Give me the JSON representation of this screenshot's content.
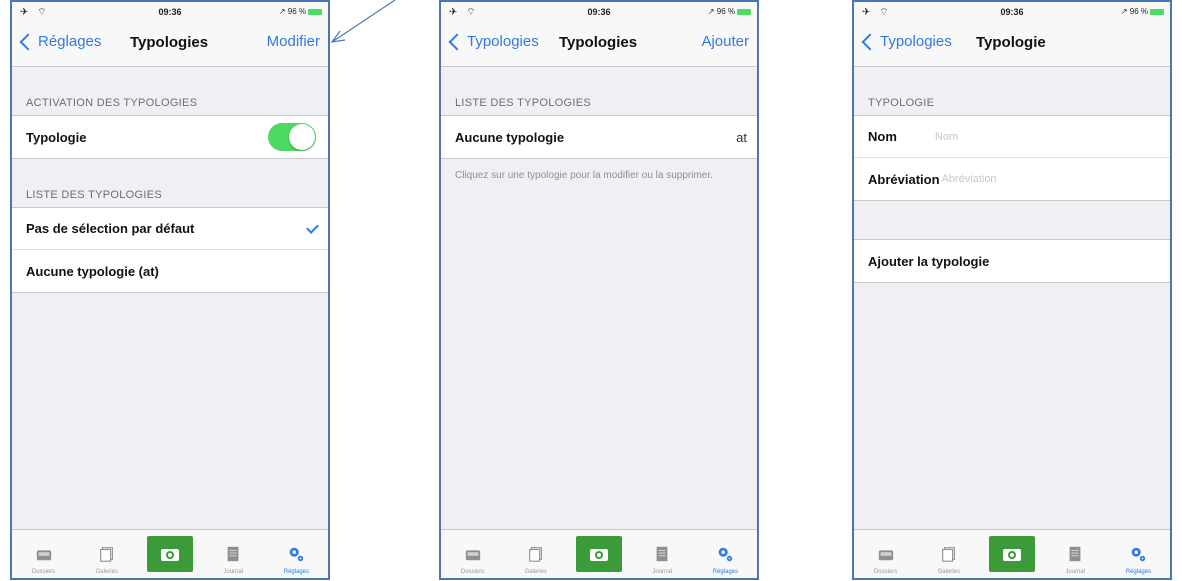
{
  "status": {
    "signal": "✈ ⌔",
    "time": "09:36",
    "battery": "↗ 96 %"
  },
  "screens": [
    {
      "nav": {
        "back": "Réglages",
        "title": "Typologies",
        "action": "Modifier"
      },
      "section1": "ACTIVATION DES TYPOLOGIES",
      "toggle_row": "Typologie",
      "toggle_on": true,
      "section2": "LISTE DES TYPOLOGIES",
      "rows": [
        "Pas de sélection par défaut",
        "Aucune typologie (at)"
      ]
    },
    {
      "nav": {
        "back": "Typologies",
        "title": "Typologies",
        "action": "Ajouter"
      },
      "section1": "LISTE DES TYPOLOGIES",
      "row": {
        "label": "Aucune typologie",
        "value": "at"
      },
      "note": "Cliquez sur une typologie pour la modifier ou la supprimer."
    },
    {
      "nav": {
        "back": "Typologies",
        "title": "Typologie"
      },
      "section1": "TYPOLOGIE",
      "fields": [
        {
          "label": "Nom",
          "placeholder": "Nom"
        },
        {
          "label": "Abréviation",
          "placeholder": "Abréviation"
        }
      ],
      "add_button": "Ajouter la typologie"
    }
  ],
  "tabs": [
    "Dossiers",
    "Galeries",
    "",
    "Journal",
    "Réglages"
  ],
  "colors": {
    "accent": "#2f7ae5",
    "toggle": "#4cd964",
    "camera": "#3b9b38",
    "frame": "#4a77b4"
  }
}
